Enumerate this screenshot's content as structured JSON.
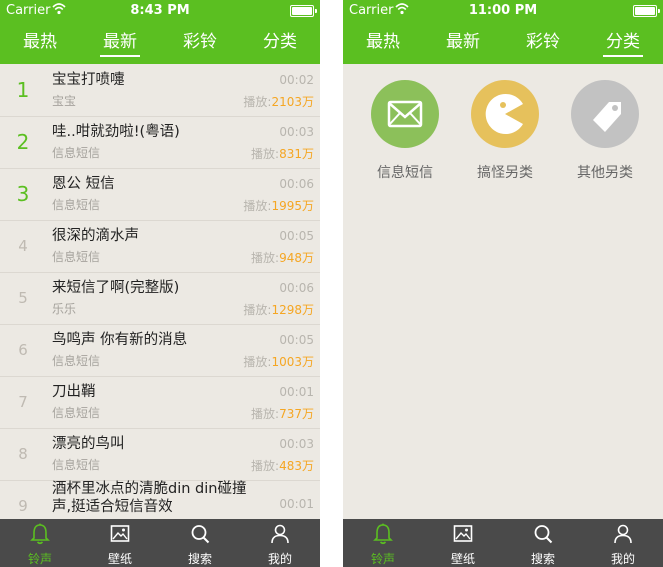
{
  "left": {
    "status": {
      "carrier": "Carrier",
      "time": "8:43 PM"
    },
    "tabs": [
      "最热",
      "最新",
      "彩铃",
      "分类"
    ],
    "active_tab": 1,
    "plays_prefix": "播放:",
    "items": [
      {
        "rank": "1",
        "title": "宝宝打喷嚏",
        "category": "宝宝",
        "duration": "00:02",
        "plays": "2103万"
      },
      {
        "rank": "2",
        "title": "哇..咁就劲啦!(粤语)",
        "category": "信息短信",
        "duration": "00:03",
        "plays": "831万"
      },
      {
        "rank": "3",
        "title": "恩公 短信",
        "category": "信息短信",
        "duration": "00:06",
        "plays": "1995万"
      },
      {
        "rank": "4",
        "title": "很深的滴水声",
        "category": "信息短信",
        "duration": "00:05",
        "plays": "948万"
      },
      {
        "rank": "5",
        "title": "来短信了啊(完整版)",
        "category": "乐乐",
        "duration": "00:06",
        "plays": "1298万"
      },
      {
        "rank": "6",
        "title": "鸟鸣声 你有新的消息",
        "category": "信息短信",
        "duration": "00:05",
        "plays": "1003万"
      },
      {
        "rank": "7",
        "title": "刀出鞘",
        "category": "信息短信",
        "duration": "00:01",
        "plays": "737万"
      },
      {
        "rank": "8",
        "title": "漂亮的鸟叫",
        "category": "信息短信",
        "duration": "00:03",
        "plays": "483万"
      },
      {
        "rank": "9",
        "title": "酒杯里冰点的清脆din din碰撞声,挺适合短信音效",
        "category": "",
        "duration": "00:01",
        "plays": ""
      }
    ]
  },
  "right": {
    "status": {
      "carrier": "Carrier",
      "time": "11:00 PM"
    },
    "tabs": [
      "最热",
      "最新",
      "彩铃",
      "分类"
    ],
    "active_tab": 3,
    "categories": [
      {
        "label": "信息短信",
        "icon": "envelope-icon",
        "color": "#8cc05a"
      },
      {
        "label": "搞怪另类",
        "icon": "pacman-icon",
        "color": "#e6c15c"
      },
      {
        "label": "其他另类",
        "icon": "tag-icon",
        "color": "#c2c2c2"
      }
    ]
  },
  "tabbar": [
    "铃声",
    "壁纸",
    "搜索",
    "我的"
  ],
  "colors": {
    "accent": "#5bbf21",
    "plays": "#f5a623",
    "tabbar": "#4a4a4a"
  }
}
